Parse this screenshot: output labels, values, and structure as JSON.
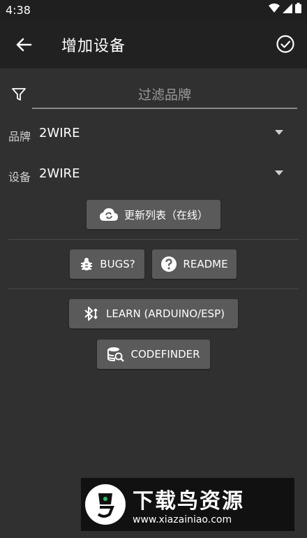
{
  "status_bar": {
    "time": "4:38"
  },
  "app_bar": {
    "title": "增加设备"
  },
  "filter": {
    "placeholder": "过滤品牌",
    "value": ""
  },
  "brand": {
    "label": "品牌",
    "value": "2WIRE"
  },
  "device": {
    "label": "设备",
    "value": "2WIRE"
  },
  "buttons": {
    "update_list": "更新列表（在线）",
    "bugs": "BUGS?",
    "readme": "README",
    "learn": "LEARN (ARDUINO/ESP)",
    "codefinder": "CODEFINDER"
  },
  "watermark": {
    "title": "下载鸟资源",
    "url": "www.xiazainiao.com"
  },
  "colors": {
    "background": "#303030",
    "appbar": "#212121",
    "button": "#5a5a5a"
  }
}
